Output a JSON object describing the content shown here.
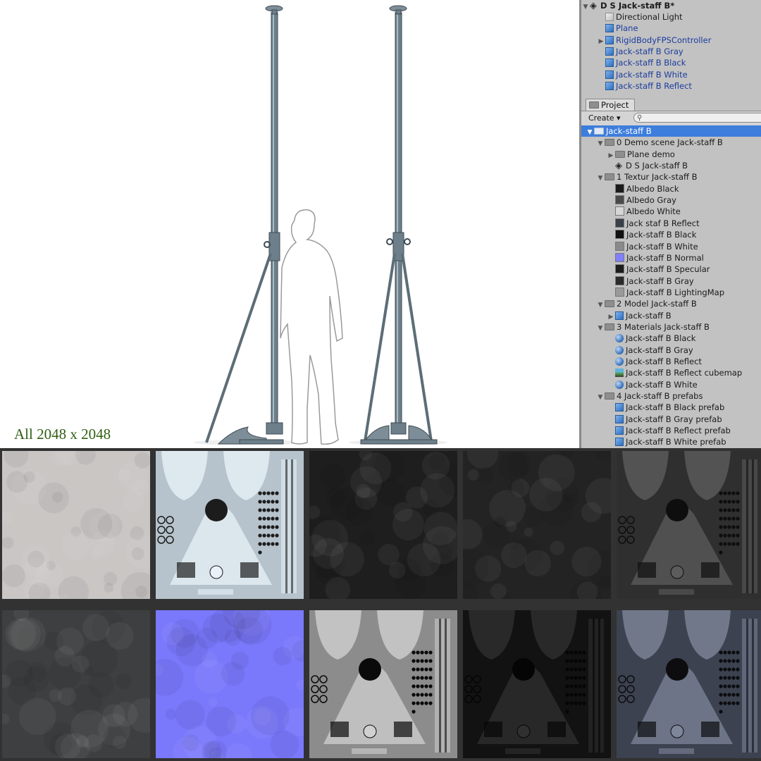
{
  "caption": "All 2048 x 2048",
  "hierarchy": {
    "scene_title": "D S Jack-staff B*",
    "items": [
      {
        "label": "Directional Light",
        "icon": "gameobject-icon",
        "style": "plain",
        "arrow": ""
      },
      {
        "label": "Plane",
        "icon": "prefab-icon",
        "style": "blue",
        "arrow": ""
      },
      {
        "label": "RigidBodyFPSController",
        "icon": "prefab-icon",
        "style": "blue",
        "arrow": "▶"
      },
      {
        "label": "Jack-staff B Gray",
        "icon": "prefab-icon",
        "style": "blue",
        "arrow": ""
      },
      {
        "label": "Jack-staff B Black",
        "icon": "prefab-icon",
        "style": "blue",
        "arrow": ""
      },
      {
        "label": "Jack-staff B White",
        "icon": "prefab-icon",
        "style": "blue",
        "arrow": ""
      },
      {
        "label": "Jack-staff B Reflect",
        "icon": "prefab-icon",
        "style": "blue",
        "arrow": ""
      }
    ]
  },
  "project": {
    "tab_label": "Project",
    "create_label": "Create ▾",
    "search_icon": "search-icon",
    "tree": [
      {
        "label": "Jack-staff B",
        "icon": "folder-icon",
        "level": 1,
        "arrow": "▼",
        "selected": true
      },
      {
        "label": "0 Demo scene Jack-staff B",
        "icon": "folder-icon",
        "level": 2,
        "arrow": "▼"
      },
      {
        "label": "Plane demo",
        "icon": "folder-icon",
        "level": 3,
        "arrow": "▶"
      },
      {
        "label": "D S Jack-staff B",
        "icon": "unity-scene-icon",
        "level": 3,
        "arrow": ""
      },
      {
        "label": "1 Textur Jack-staff B",
        "icon": "folder-icon",
        "level": 2,
        "arrow": "▼"
      },
      {
        "label": "Albedo Black",
        "icon": "texture-icon",
        "swatch": "#1a1a1a",
        "level": 3,
        "arrow": ""
      },
      {
        "label": "Albedo Gray",
        "icon": "texture-icon",
        "swatch": "#4a4a4a",
        "level": 3,
        "arrow": ""
      },
      {
        "label": "Albedo White",
        "icon": "texture-icon",
        "swatch": "#d6d6d6",
        "level": 3,
        "arrow": ""
      },
      {
        "label": "Jack staf B Reflect",
        "icon": "texture-icon",
        "swatch": "#3b3f48",
        "level": 3,
        "arrow": ""
      },
      {
        "label": "Jack-staff B Black",
        "icon": "texture-icon",
        "swatch": "#111111",
        "level": 3,
        "arrow": ""
      },
      {
        "label": "Jack-staff B White",
        "icon": "texture-icon",
        "swatch": "#8a8a8a",
        "level": 3,
        "arrow": ""
      },
      {
        "label": "Jack-staff B  Normal",
        "icon": "texture-icon",
        "swatch": "#7f7fff",
        "level": 3,
        "arrow": ""
      },
      {
        "label": "Jack-staff B  Specular",
        "icon": "texture-icon",
        "swatch": "#1c1c1c",
        "level": 3,
        "arrow": ""
      },
      {
        "label": "Jack-staff B Gray",
        "icon": "texture-icon",
        "swatch": "#2a2a2a",
        "level": 3,
        "arrow": ""
      },
      {
        "label": "Jack-staff B LightingMap",
        "icon": "texture-icon",
        "swatch": "#9a9a9a",
        "level": 3,
        "arrow": ""
      },
      {
        "label": "2 Model Jack-staff B",
        "icon": "folder-icon",
        "level": 2,
        "arrow": "▼"
      },
      {
        "label": "Jack-staff B",
        "icon": "model-icon",
        "level": 3,
        "arrow": "▶"
      },
      {
        "label": "3 Materials  Jack-staff B",
        "icon": "folder-icon",
        "level": 2,
        "arrow": "▼"
      },
      {
        "label": "Jack-staff B Black",
        "icon": "material-icon",
        "level": 3,
        "arrow": ""
      },
      {
        "label": "Jack-staff B Gray",
        "icon": "material-icon",
        "level": 3,
        "arrow": ""
      },
      {
        "label": "Jack-staff B Reflect",
        "icon": "material-icon",
        "level": 3,
        "arrow": ""
      },
      {
        "label": "Jack-staff B Reflect cubemap",
        "icon": "cubemap-icon",
        "level": 3,
        "arrow": ""
      },
      {
        "label": "Jack-staff B White",
        "icon": "material-icon",
        "level": 3,
        "arrow": ""
      },
      {
        "label": "4 Jack-staff B  prefabs",
        "icon": "folder-icon",
        "level": 2,
        "arrow": "▼"
      },
      {
        "label": "Jack-staff B Black prefab",
        "icon": "prefab-icon",
        "level": 3,
        "arrow": ""
      },
      {
        "label": "Jack-staff B Gray prefab",
        "icon": "prefab-icon",
        "level": 3,
        "arrow": ""
      },
      {
        "label": "Jack-staff B Reflect prefab",
        "icon": "prefab-icon",
        "level": 3,
        "arrow": ""
      },
      {
        "label": "Jack-staff B White prefab",
        "icon": "prefab-icon",
        "level": 3,
        "arrow": ""
      }
    ]
  },
  "textures": [
    {
      "name": "albedo-white-texture",
      "kind": "noise",
      "base": "#c9c6c4"
    },
    {
      "name": "lightingmap-texture",
      "kind": "map",
      "base": "#b6c3cc",
      "fg": "#e8f2f8",
      "dark": "#1c1c1c"
    },
    {
      "name": "albedo-black-texture",
      "kind": "noise",
      "base": "#1e1e1e"
    },
    {
      "name": "specular-texture",
      "kind": "noise",
      "base": "#232323"
    },
    {
      "name": "gray-texture",
      "kind": "map",
      "base": "#2f2f2f",
      "fg": "#5c5c5c",
      "dark": "#0e0e0e"
    },
    {
      "name": "albedo-gray-texture",
      "kind": "noise",
      "base": "#3e3f41"
    },
    {
      "name": "normal-map-texture",
      "kind": "noise",
      "base": "#7a78fb"
    },
    {
      "name": "white-texture",
      "kind": "map",
      "base": "#8c8c8c",
      "fg": "#d0d0d0",
      "dark": "#0a0a0a"
    },
    {
      "name": "black-texture",
      "kind": "map",
      "base": "#121212",
      "fg": "#303030",
      "dark": "#050505"
    },
    {
      "name": "reflect-texture",
      "kind": "map",
      "base": "#3d4250",
      "fg": "#7e8699",
      "dark": "#0d0d10"
    }
  ]
}
